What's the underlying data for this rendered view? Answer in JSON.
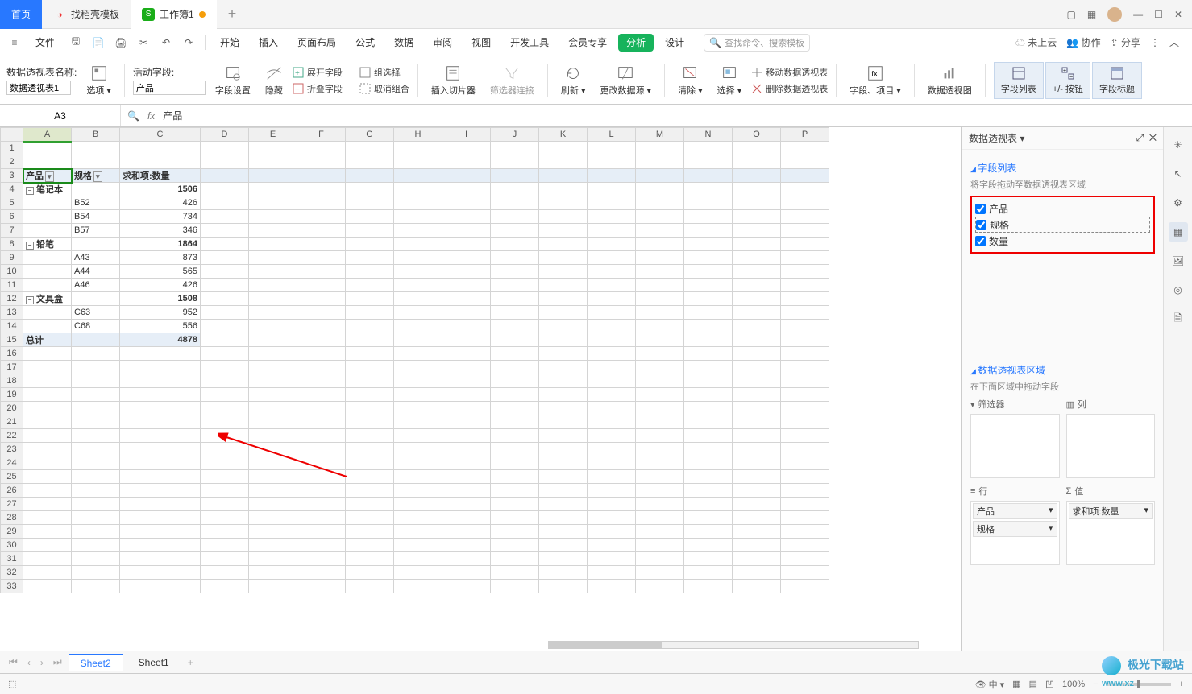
{
  "titlebar": {
    "home": "首页",
    "tab1": "找稻壳模板",
    "tab2": "工作簿1"
  },
  "menubar": {
    "file": "文件",
    "items": [
      "开始",
      "插入",
      "页面布局",
      "公式",
      "数据",
      "审阅",
      "视图",
      "开发工具",
      "会员专享"
    ],
    "analysis": "分析",
    "design": "设计",
    "search_ph": "查找命令、搜索模板",
    "cloud": "未上云",
    "coop": "协作",
    "share": "分享"
  },
  "toolbar": {
    "pivot_name_label": "数据透视表名称:",
    "pivot_name_value": "数据透视表1",
    "options": "选项",
    "active_field_label": "活动字段:",
    "active_field_value": "产品",
    "field_settings": "字段设置",
    "hide": "隐藏",
    "expand_field": "展开字段",
    "collapse_field": "折叠字段",
    "group_sel": "组选择",
    "ungroup": "取消组合",
    "slicer": "插入切片器",
    "filter_conn": "筛选器连接",
    "refresh": "刷新",
    "change_src": "更改数据源",
    "clear": "清除",
    "select_btn": "选择",
    "move_pivot": "移动数据透视表",
    "del_pivot": "删除数据透视表",
    "fields_items": "字段、项目",
    "pivot_chart": "数据透视图",
    "tgl_fieldlist": "字段列表",
    "tgl_pm": "+/- 按钮",
    "tgl_hdr": "字段标题"
  },
  "fml_bar": {
    "ref": "A3",
    "value": "产品"
  },
  "cols": [
    "A",
    "B",
    "C",
    "D",
    "E",
    "F",
    "G",
    "H",
    "I",
    "J",
    "K",
    "L",
    "M",
    "N",
    "O",
    "P"
  ],
  "pivot_data": {
    "hdr_product": "产品",
    "hdr_spec": "规格",
    "hdr_sum": "求和项:数量",
    "rows": [
      {
        "type": "grp",
        "a": "笔记本",
        "c": "1506",
        "bold": true
      },
      {
        "type": "item",
        "b": "B52",
        "c": "426"
      },
      {
        "type": "item",
        "b": "B54",
        "c": "734"
      },
      {
        "type": "item",
        "b": "B57",
        "c": "346"
      },
      {
        "type": "grp",
        "a": "铅笔",
        "c": "1864",
        "bold": true
      },
      {
        "type": "item",
        "b": "A43",
        "c": "873"
      },
      {
        "type": "item",
        "b": "A44",
        "c": "565"
      },
      {
        "type": "item",
        "b": "A46",
        "c": "426"
      },
      {
        "type": "grp",
        "a": "文具盒",
        "c": "1508",
        "bold": true
      },
      {
        "type": "item",
        "b": "C63",
        "c": "952"
      },
      {
        "type": "item",
        "b": "C68",
        "c": "556"
      },
      {
        "type": "total",
        "a": "总计",
        "c": "4878",
        "bold": true
      }
    ]
  },
  "pane": {
    "title": "数据透视表",
    "sec_fieldlist": "字段列表",
    "hint_drag": "将字段拖动至数据透视表区域",
    "fields": [
      "产品",
      "规格",
      "数量"
    ],
    "sec_areas": "数据透视表区域",
    "hint_areas": "在下面区域中拖动字段",
    "area_filter": "筛选器",
    "area_col": "列",
    "area_row": "行",
    "area_val": "值",
    "row_items": [
      "产品",
      "规格"
    ],
    "val_items": [
      "求和项:数量"
    ]
  },
  "sheets": {
    "s1": "Sheet2",
    "s2": "Sheet1"
  },
  "statusbar": {
    "zoom": "100%"
  },
  "watermark": {
    "text1": "极光下载站",
    "text2": "www.xz"
  }
}
